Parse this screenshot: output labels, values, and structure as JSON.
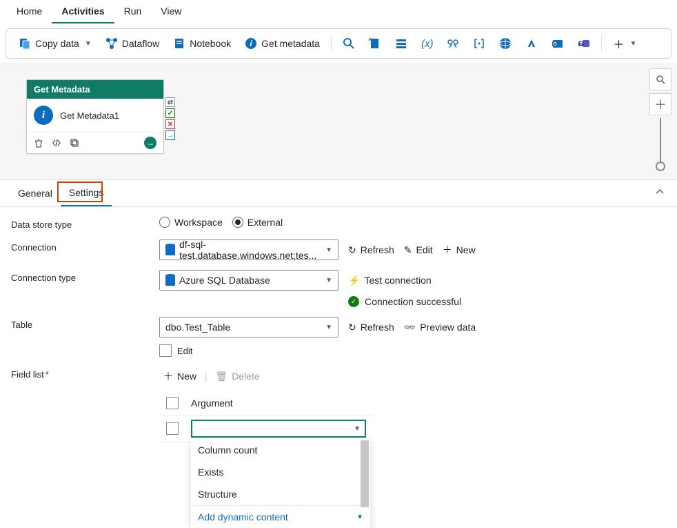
{
  "topTabs": {
    "home": "Home",
    "activities": "Activities",
    "run": "Run",
    "view": "View"
  },
  "toolbar": {
    "copyData": "Copy data",
    "dataflow": "Dataflow",
    "notebook": "Notebook",
    "getMetadata": "Get metadata"
  },
  "activity": {
    "header": "Get Metadata",
    "name": "Get Metadata1"
  },
  "panelTabs": {
    "general": "General",
    "settings": "Settings"
  },
  "form": {
    "dataStoreType": {
      "label": "Data store type",
      "workspace": "Workspace",
      "external": "External"
    },
    "connection": {
      "label": "Connection",
      "value": "df-sql-test.database.windows.net;tes...",
      "refresh": "Refresh",
      "edit": "Edit",
      "new": "New"
    },
    "connectionType": {
      "label": "Connection type",
      "value": "Azure SQL Database",
      "test": "Test connection",
      "success": "Connection successful"
    },
    "table": {
      "label": "Table",
      "value": "dbo.Test_Table",
      "refresh": "Refresh",
      "preview": "Preview data",
      "editCheck": "Edit"
    },
    "fieldList": {
      "label": "Field list",
      "new": "New",
      "delete": "Delete",
      "argHeader": "Argument",
      "options": {
        "columnCount": "Column count",
        "exists": "Exists",
        "structure": "Structure",
        "dynamic": "Add dynamic content"
      }
    }
  }
}
